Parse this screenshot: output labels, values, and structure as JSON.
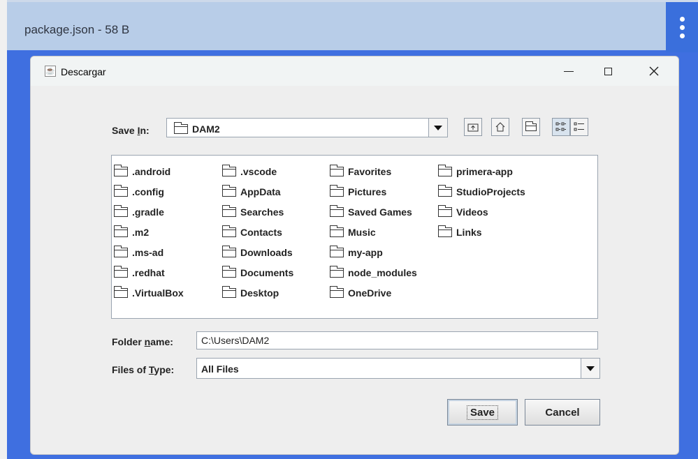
{
  "window": {
    "title": "package.json - 58 B",
    "menu_icon": "more-vertical-icon"
  },
  "dialog": {
    "title": "Descargar",
    "app_icon": "java-cup-icon",
    "controls": [
      "minimize-icon",
      "maximize-icon",
      "close-icon"
    ]
  },
  "save_in": {
    "label_pre": "Save ",
    "label_key": "I",
    "label_post": "n:",
    "value": "DAM2"
  },
  "toolbar": {
    "buttons": [
      "up-folder-icon",
      "home-icon",
      "new-folder-icon",
      "list-view-icon",
      "details-view-icon"
    ],
    "active": "list-view-icon"
  },
  "files": {
    "columns": [
      [
        ".android",
        ".config",
        ".gradle",
        ".m2",
        ".ms-ad",
        ".redhat",
        ".VirtualBox"
      ],
      [
        ".vscode",
        "AppData",
        "Searches",
        "Contacts",
        "Downloads",
        "Documents",
        "Desktop"
      ],
      [
        "Favorites",
        "Pictures",
        "Saved Games",
        "Music",
        "my-app",
        "node_modules",
        "OneDrive"
      ],
      [
        "primera-app",
        "StudioProjects",
        "Videos",
        "Links"
      ]
    ]
  },
  "folder_name": {
    "label_pre": "Folder ",
    "label_key": "n",
    "label_post": "ame:",
    "value": "C:\\Users\\DAM2"
  },
  "file_type": {
    "label_pre": "Files of ",
    "label_key": "T",
    "label_post": "ype:",
    "value": "All Files"
  },
  "buttons": {
    "save": "Save",
    "cancel": "Cancel"
  }
}
